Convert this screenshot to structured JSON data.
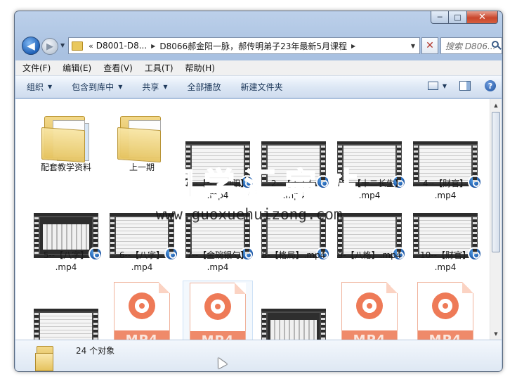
{
  "window": {
    "caption_buttons": {
      "minimize": "─",
      "maximize": "□",
      "close": "✕"
    }
  },
  "nav": {
    "back_glyph": "◀",
    "forward_glyph": "▶",
    "breadcrumb_overflow": "«",
    "breadcrumb": [
      "D8001-D8...",
      "D8066郝金阳一脉，郝传明弟子23年最新5月课程"
    ],
    "search_placeholder": "搜索 D806..."
  },
  "menu": [
    "文件(F)",
    "编辑(E)",
    "查看(V)",
    "工具(T)",
    "帮助(H)"
  ],
  "toolbar": {
    "organize": "组织",
    "include_in_library": "包含到库中",
    "share": "共享",
    "play_all": "全部播放",
    "new_folder": "新建文件夹",
    "help": "?"
  },
  "files": [
    {
      "name": "配套教学资料",
      "kind": "folder"
    },
    {
      "name": "上一期",
      "kind": "folder"
    },
    {
      "name": "1--【十干阴阳】.mp4",
      "line1": "1--【十干阴阳】",
      "line2": ".mp4",
      "kind": "video"
    },
    {
      "name": "2--【十干】.mp4",
      "line1": "2--【十干】",
      "line2": ".mp4",
      "kind": "video"
    },
    {
      "name": "03--【十二长生】.mp4",
      "line1": "03--【十二长生】",
      "line2": ".mp4",
      "kind": "video"
    },
    {
      "name": "4--【财官】.mp4",
      "line1": "4--【财官】",
      "line2": ".mp4",
      "kind": "video"
    },
    {
      "name": "5--【八字】.mp4",
      "line1": "5--【八字】",
      "line2": ".mp4",
      "kind": "video"
    },
    {
      "name": "6--【八字】.mp4",
      "line1": "6--【八字】",
      "line2": ".mp4",
      "kind": "video"
    },
    {
      "name": "7--【金碗银勺】.mp4",
      "line1": "7--【金碗银勺】",
      "line2": ".mp4",
      "kind": "video"
    },
    {
      "name": "8-【格局】.mp4",
      "line1": "8-【格局】.mp4",
      "line2": "",
      "kind": "video"
    },
    {
      "name": "9-【八格】.mp4",
      "line1": "9-【八格】.mp4",
      "line2": "",
      "kind": "video"
    },
    {
      "name": "10--【财官】.mp4",
      "line1": "10--【财官】",
      "line2": ".mp4",
      "kind": "video"
    },
    {
      "kind": "video"
    },
    {
      "kind": "mp4file",
      "badge": "MP4"
    },
    {
      "kind": "mp4file",
      "badge": "MP4"
    },
    {
      "kind": "video"
    },
    {
      "kind": "mp4file",
      "badge": "MP4"
    },
    {
      "kind": "mp4file",
      "badge": "MP4"
    }
  ],
  "watermark": {
    "title": "国学汇宗站",
    "url": "www.guoxuehuizong.com"
  },
  "status": {
    "item_count": "24 个对象"
  }
}
